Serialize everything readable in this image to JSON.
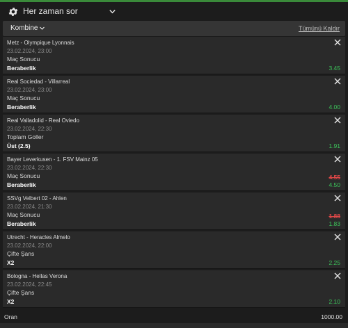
{
  "header": {
    "ask_label": "Her zaman sor"
  },
  "bet_type": {
    "label": "Kombine",
    "clear_all": "Tümünü Kaldır"
  },
  "selections": [
    {
      "match": "Metz - Olympique Lyonnais",
      "date": "23.02.2024, 23:00",
      "market": "Maç Sonucu",
      "pick": "Beraberlik",
      "old_odds": "",
      "odds": "3.45"
    },
    {
      "match": "Real Sociedad - Villarreal",
      "date": "23.02.2024, 23:00",
      "market": "Maç Sonucu",
      "pick": "Beraberlik",
      "old_odds": "",
      "odds": "4.00"
    },
    {
      "match": "Real Valladolid - Real Oviedo",
      "date": "23.02.2024, 22:30",
      "market": "Toplam Goller",
      "pick": "Üst (2.5)",
      "old_odds": "",
      "odds": "1.91"
    },
    {
      "match": "Bayer Leverkusen - 1. FSV Mainz 05",
      "date": "23.02.2024, 22:30",
      "market": "Maç Sonucu",
      "pick": "Beraberlik",
      "old_odds": "4.55",
      "odds": "4.50"
    },
    {
      "match": "SSVg Velbert 02 - Ahlen",
      "date": "23.02.2024, 21:30",
      "market": "Maç Sonucu",
      "pick": "Beraberlik",
      "old_odds": "1.88",
      "odds": "1.83"
    },
    {
      "match": "Utrecht - Heracles Almelo",
      "date": "23.02.2024, 22:00",
      "market": "Çifte Şans",
      "pick": "X2",
      "old_odds": "",
      "odds": "2.25"
    },
    {
      "match": "Bologna - Hellas Verona",
      "date": "23.02.2024, 22:45",
      "market": "Çifte Şans",
      "pick": "X2",
      "old_odds": "",
      "odds": "2.10"
    }
  ],
  "total": {
    "label": "Oran",
    "value": "1000.00"
  },
  "colors": {
    "odds_green": "#3cc45a",
    "old_odds_red": "#e04848",
    "top_line": "#3a8a3a"
  },
  "icons": {
    "settings": "gear-icon",
    "ask_dropdown": "chevron-down-icon",
    "type_dropdown": "chevron-down-icon",
    "remove": "close-icon"
  }
}
